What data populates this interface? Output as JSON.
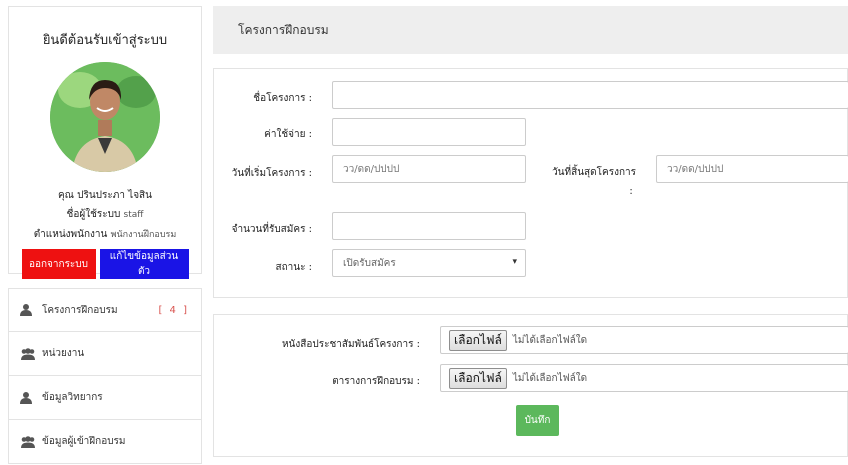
{
  "profile": {
    "welcome": "ยินดีต้อนรับเข้าสู่ระบบ",
    "name": "คุณ ปรินประภา ไจสิน",
    "username_label": "ชื่อผู้ใช้ระบบ",
    "username_value": "staff",
    "position_label": "ตำแหน่งพนักงาน",
    "position_value": "พนักงานฝึกอบรม",
    "logout_label": "ออกจากระบบ",
    "edit_label": "แก้ไขข้อมูลส่วนตัว",
    "logout_color": "#ee1111",
    "edit_color": "#1a14e6"
  },
  "menu": {
    "items": [
      {
        "label": "โครงการฝึกอบรม",
        "icon": "user-icon",
        "count": "[ 4 ]"
      },
      {
        "label": "หน่วยงาน",
        "icon": "users-icon"
      },
      {
        "label": "ข้อมูลวิทยากร",
        "icon": "user-icon"
      },
      {
        "label": "ข้อมูลผู้เข้าฝึกอบรม",
        "icon": "users-icon"
      }
    ]
  },
  "header": {
    "title": "โครงการฝึกอบรม"
  },
  "form": {
    "project_name_label": "ชื่อโครงการ :",
    "project_name_value": "",
    "cost_label": "ค่าใช้จ่าย :",
    "cost_value": "",
    "start_label": "วันที่เริ่มโครงการ :",
    "start_placeholder": "วว/ดด/ปปปป",
    "end_label": "วันที่สิ้นสุดโครงการ",
    "end_label_colon": ":",
    "end_placeholder": "วว/ดด/ปปปป",
    "applicants_label": "จำนวนที่รับสมัคร :",
    "applicants_value": "",
    "status_label": "สถานะ :",
    "status_value": "เปิดรับสมัคร"
  },
  "upload": {
    "pr_label": "หนังสือประชาสัมพันธ์โครงการ :",
    "schedule_label": "ตารางการฝึกอบรม :",
    "choose_file": "เลือกไฟล์",
    "no_file": "ไม่ได้เลือกไฟล์ใด",
    "save_label": "บันทึก",
    "save_color": "#5cb85c"
  }
}
